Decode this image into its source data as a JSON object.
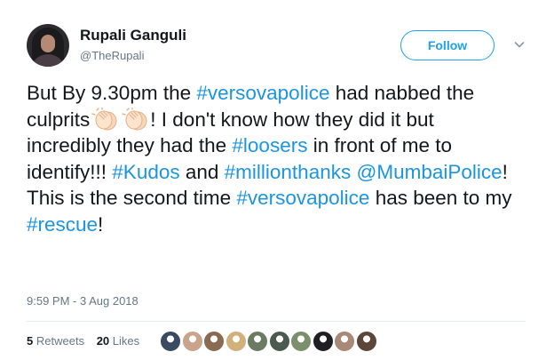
{
  "author": {
    "name": "Rupali Ganguli",
    "handle": "@TheRupali"
  },
  "follow": {
    "label": "Follow"
  },
  "tweet": {
    "segments": [
      {
        "text": "But By 9.30pm the ",
        "type": "text"
      },
      {
        "text": "#versovapolice",
        "type": "tag"
      },
      {
        "text": " had nabbed the culprits",
        "type": "text"
      },
      {
        "text": "",
        "type": "clap"
      },
      {
        "text": "",
        "type": "clap"
      },
      {
        "text": "! I don't know how they did it but incredibly they had the ",
        "type": "text"
      },
      {
        "text": "#loosers",
        "type": "tag"
      },
      {
        "text": " in front of me to identify!!! ",
        "type": "text"
      },
      {
        "text": "#Kudos",
        "type": "tag"
      },
      {
        "text": " and ",
        "type": "text"
      },
      {
        "text": "#millionthanks",
        "type": "tag"
      },
      {
        "text": " ",
        "type": "text"
      },
      {
        "text": "@MumbaiPolice",
        "type": "tag"
      },
      {
        "text": "! This is the second time ",
        "type": "text"
      },
      {
        "text": "#versovapolice",
        "type": "tag"
      },
      {
        "text": " has been to my ",
        "type": "text"
      },
      {
        "text": "#rescue",
        "type": "tag"
      },
      {
        "text": "!",
        "type": "text"
      }
    ]
  },
  "timestamp": "9:59 PM - 3 Aug 2018",
  "stats": {
    "retweets_count": "5",
    "retweets_label": "Retweets",
    "likes_count": "20",
    "likes_label": "Likes"
  },
  "likers": [
    {
      "color": "#3b4a63"
    },
    {
      "color": "#c9a38b"
    },
    {
      "color": "#8a6a52"
    },
    {
      "color": "#d2b07a"
    },
    {
      "color": "#6b7b62"
    },
    {
      "color": "#4b5a4e"
    },
    {
      "color": "#7a8f6a"
    },
    {
      "color": "#1f1f24"
    },
    {
      "color": "#a88876"
    },
    {
      "color": "#5c4638"
    }
  ],
  "colors": {
    "accent": "#1da1f2",
    "link": "#1b95e0",
    "muted": "#657786"
  }
}
